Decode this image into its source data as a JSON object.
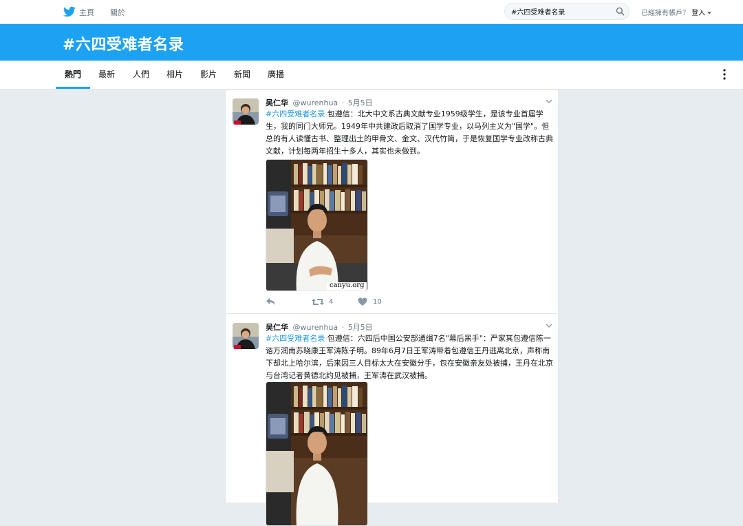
{
  "nav": {
    "home": "主頁",
    "about": "關於"
  },
  "search": {
    "value": "#六四受难者名录"
  },
  "login": {
    "prompt": "已經擁有帳戶？",
    "link": "登入"
  },
  "hero": {
    "title": "#六四受难者名录"
  },
  "tabs": [
    {
      "label": "熱門"
    },
    {
      "label": "最新"
    },
    {
      "label": "人們"
    },
    {
      "label": "相片"
    },
    {
      "label": "影片"
    },
    {
      "label": "新聞"
    },
    {
      "label": "廣播"
    }
  ],
  "tweets": [
    {
      "name": "吴仁华",
      "handle": "@wurenhua",
      "separator": "·",
      "time": "5月5日",
      "hashtag": "#六四受难者名录",
      "text": " 包遵信：北大中文系古典文献专业1959级学生，是该专业首届学生，我的同门大师兄。1949年中共建政后取消了国学专业，以马列主义为\"国学\"。但总的有人读懂古书、整理出土的甲骨文、金文、汉代竹简，于是恢复国学专业改称古典文献，计划每两年招生十多人，其实也未做到。",
      "media_caption": "canyu.org",
      "retweets": "4",
      "likes": "10"
    },
    {
      "name": "吴仁华",
      "handle": "@wurenhua",
      "separator": "·",
      "time": "5月5日",
      "hashtag": "#六四受难者名录",
      "text": " 包遵信：六四后中国公安部通缉7名\"幕后黑手\"：严家其包遵信陈一谘万润南苏晓康王军涛陈子明。89年6月7日王军涛带着包遵信王丹逃离北京，声称南下却北上哈尔滨，后来因三人目标太大在安徽分手，包在安徽亲友处被捕，王丹在北京与台湾记者黄德北约见被捕，王军涛在武汉被捕。"
    }
  ],
  "colors": {
    "brand": "#1da1f2",
    "hashtag": "#1b95e0",
    "muted": "#66757f",
    "background": "#e6ecf0"
  }
}
